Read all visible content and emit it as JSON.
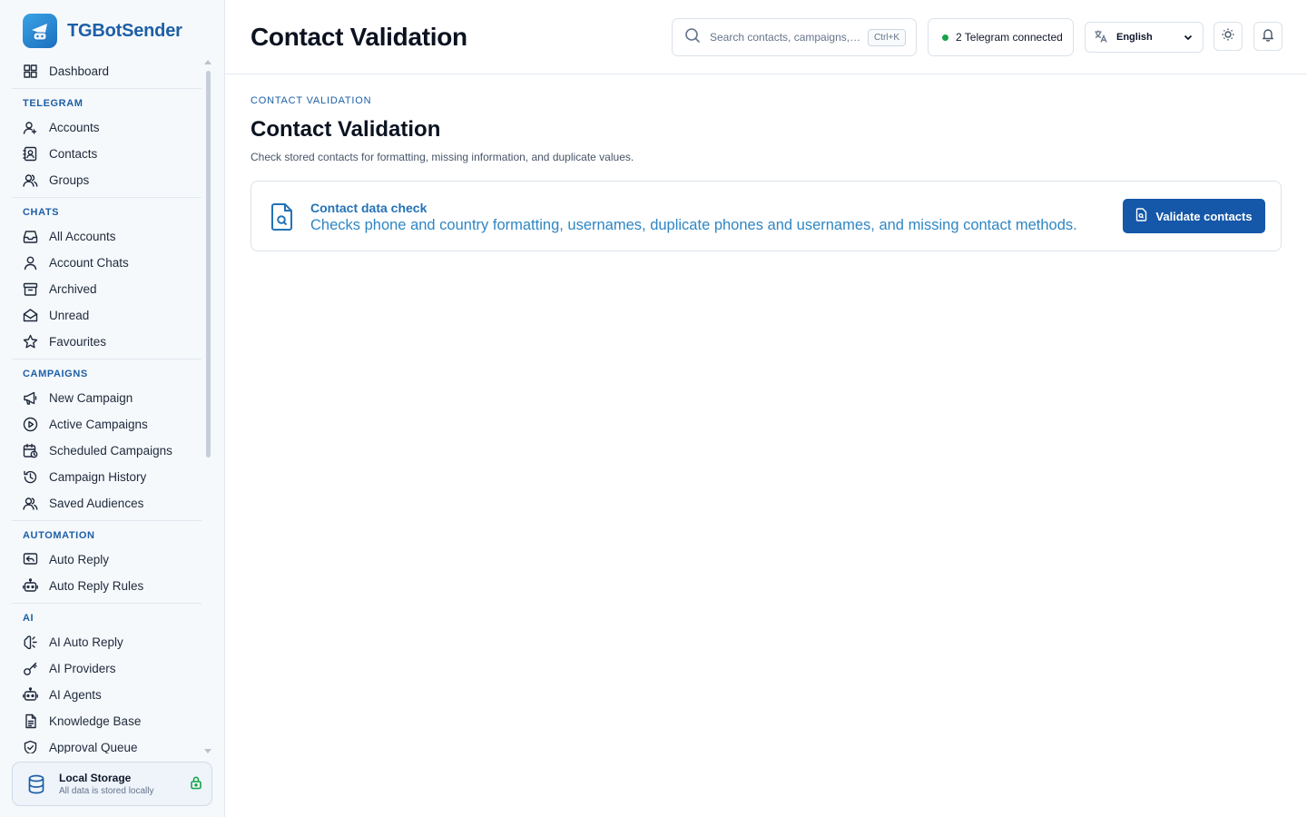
{
  "app": {
    "name": "TGBotSender"
  },
  "sidebar": {
    "top": [
      {
        "label": "Dashboard",
        "icon": "dashboard-icon"
      }
    ],
    "sections": [
      {
        "title": "TELEGRAM",
        "items": [
          {
            "label": "Accounts",
            "icon": "account-icon"
          },
          {
            "label": "Contacts",
            "icon": "contacts-icon"
          },
          {
            "label": "Groups",
            "icon": "groups-icon"
          }
        ]
      },
      {
        "title": "CHATS",
        "items": [
          {
            "label": "All Accounts",
            "icon": "inbox-icon"
          },
          {
            "label": "Account Chats",
            "icon": "user-icon"
          },
          {
            "label": "Archived",
            "icon": "archive-icon"
          },
          {
            "label": "Unread",
            "icon": "mail-open-icon"
          },
          {
            "label": "Favourites",
            "icon": "star-icon"
          }
        ]
      },
      {
        "title": "CAMPAIGNS",
        "items": [
          {
            "label": "New Campaign",
            "icon": "megaphone-icon"
          },
          {
            "label": "Active Campaigns",
            "icon": "play-circle-icon"
          },
          {
            "label": "Scheduled Campaigns",
            "icon": "calendar-clock-icon"
          },
          {
            "label": "Campaign History",
            "icon": "history-icon"
          },
          {
            "label": "Saved Audiences",
            "icon": "audience-icon"
          }
        ]
      },
      {
        "title": "AUTOMATION",
        "items": [
          {
            "label": "Auto Reply",
            "icon": "reply-icon"
          },
          {
            "label": "Auto Reply Rules",
            "icon": "bot-icon"
          }
        ]
      },
      {
        "title": "AI",
        "items": [
          {
            "label": "AI Auto Reply",
            "icon": "brain-icon"
          },
          {
            "label": "AI Providers",
            "icon": "key-icon"
          },
          {
            "label": "AI Agents",
            "icon": "bot-icon"
          },
          {
            "label": "Knowledge Base",
            "icon": "document-icon"
          },
          {
            "label": "Approval Queue",
            "icon": "shield-check-icon"
          }
        ]
      }
    ],
    "storage": {
      "title": "Local Storage",
      "subtitle": "All data is stored locally"
    }
  },
  "header": {
    "title": "Contact Validation",
    "search": {
      "placeholder": "Search contacts, campaigns, t...",
      "shortcut": "Ctrl+K"
    },
    "status": "2 Telegram connected",
    "language": "English"
  },
  "main": {
    "breadcrumb": "CONTACT VALIDATION",
    "title": "Contact Validation",
    "description": "Check stored contacts for formatting, missing information, and duplicate values.",
    "card": {
      "title": "Contact data check",
      "description": "Checks phone and country formatting, usernames, duplicate phones and usernames, and missing contact methods.",
      "button": "Validate contacts"
    }
  },
  "colors": {
    "accent": "#1557a8",
    "brand": "#1d5fa6",
    "status_ok": "#16a34a"
  }
}
